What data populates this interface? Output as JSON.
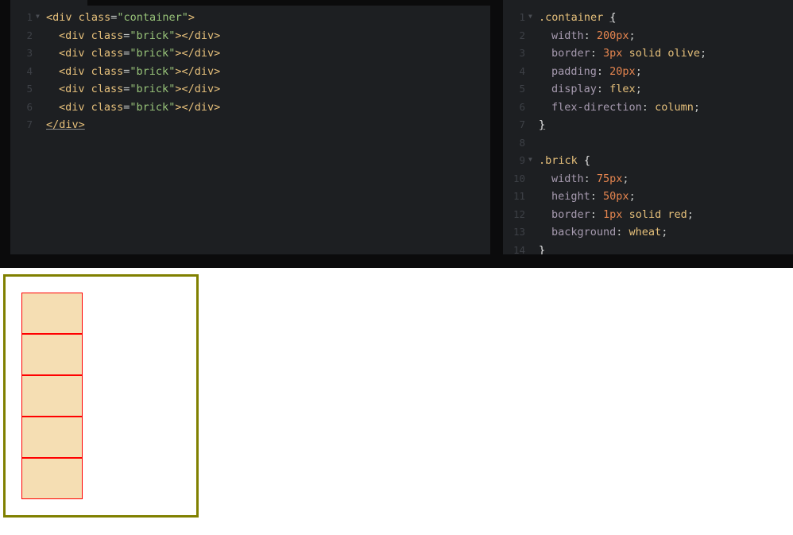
{
  "html_editor": {
    "lines": [
      {
        "n": "1",
        "fold": true,
        "indent": 0,
        "parts": [
          [
            "tag",
            "<div "
          ],
          [
            "attr",
            "class"
          ],
          [
            "punc",
            "="
          ],
          [
            "val",
            "\"container\""
          ],
          [
            "tag",
            ">"
          ]
        ]
      },
      {
        "n": "2",
        "fold": false,
        "indent": 1,
        "parts": [
          [
            "tag",
            "<div "
          ],
          [
            "attr",
            "class"
          ],
          [
            "punc",
            "="
          ],
          [
            "val",
            "\"brick\""
          ],
          [
            "tag",
            "></div>"
          ]
        ]
      },
      {
        "n": "3",
        "fold": false,
        "indent": 1,
        "parts": [
          [
            "tag",
            "<div "
          ],
          [
            "attr",
            "class"
          ],
          [
            "punc",
            "="
          ],
          [
            "val",
            "\"brick\""
          ],
          [
            "tag",
            "></div>"
          ]
        ]
      },
      {
        "n": "4",
        "fold": false,
        "indent": 1,
        "parts": [
          [
            "tag",
            "<div "
          ],
          [
            "attr",
            "class"
          ],
          [
            "punc",
            "="
          ],
          [
            "val",
            "\"brick\""
          ],
          [
            "tag",
            "></div>"
          ]
        ]
      },
      {
        "n": "5",
        "fold": false,
        "indent": 1,
        "parts": [
          [
            "tag",
            "<div "
          ],
          [
            "attr",
            "class"
          ],
          [
            "punc",
            "="
          ],
          [
            "val",
            "\"brick\""
          ],
          [
            "tag",
            "></div>"
          ]
        ]
      },
      {
        "n": "6",
        "fold": false,
        "indent": 1,
        "parts": [
          [
            "tag",
            "<div "
          ],
          [
            "attr",
            "class"
          ],
          [
            "punc",
            "="
          ],
          [
            "val",
            "\"brick\""
          ],
          [
            "tag",
            "></div>"
          ]
        ]
      },
      {
        "n": "7",
        "fold": false,
        "indent": 0,
        "parts": [
          [
            "tag_under",
            "</div>"
          ]
        ]
      }
    ]
  },
  "css_editor": {
    "lines": [
      {
        "n": "1",
        "fold": true,
        "indent": 0,
        "parts": [
          [
            "sel",
            ".container "
          ],
          [
            "brace_under",
            "{"
          ]
        ]
      },
      {
        "n": "2",
        "fold": false,
        "indent": 1,
        "parts": [
          [
            "prop",
            "width"
          ],
          [
            "punc",
            ": "
          ],
          [
            "num",
            "200px"
          ],
          [
            "punc",
            ";"
          ]
        ]
      },
      {
        "n": "3",
        "fold": false,
        "indent": 1,
        "parts": [
          [
            "prop",
            "border"
          ],
          [
            "punc",
            ": "
          ],
          [
            "num",
            "3px"
          ],
          [
            "kw",
            " solid olive"
          ],
          [
            "punc",
            ";"
          ]
        ]
      },
      {
        "n": "4",
        "fold": false,
        "indent": 1,
        "parts": [
          [
            "prop",
            "padding"
          ],
          [
            "punc",
            ": "
          ],
          [
            "num",
            "20px"
          ],
          [
            "punc",
            ";"
          ]
        ]
      },
      {
        "n": "5",
        "fold": false,
        "indent": 1,
        "parts": [
          [
            "prop",
            "display"
          ],
          [
            "punc",
            ": "
          ],
          [
            "kw",
            "flex"
          ],
          [
            "punc",
            ";"
          ]
        ]
      },
      {
        "n": "6",
        "fold": false,
        "indent": 1,
        "parts": [
          [
            "prop",
            "flex-direction"
          ],
          [
            "punc",
            ": "
          ],
          [
            "kw",
            "column"
          ],
          [
            "punc",
            ";"
          ]
        ]
      },
      {
        "n": "7",
        "fold": false,
        "indent": 0,
        "parts": [
          [
            "brace_under",
            "}"
          ]
        ]
      },
      {
        "n": "8",
        "fold": false,
        "indent": 0,
        "parts": []
      },
      {
        "n": "9",
        "fold": true,
        "indent": 0,
        "parts": [
          [
            "sel",
            ".brick "
          ],
          [
            "brace",
            "{"
          ]
        ]
      },
      {
        "n": "10",
        "fold": false,
        "indent": 1,
        "parts": [
          [
            "prop",
            "width"
          ],
          [
            "punc",
            ": "
          ],
          [
            "num",
            "75px"
          ],
          [
            "punc",
            ";"
          ]
        ]
      },
      {
        "n": "11",
        "fold": false,
        "indent": 1,
        "parts": [
          [
            "prop",
            "height"
          ],
          [
            "punc",
            ": "
          ],
          [
            "num",
            "50px"
          ],
          [
            "punc",
            ";"
          ]
        ]
      },
      {
        "n": "12",
        "fold": false,
        "indent": 1,
        "parts": [
          [
            "prop",
            "border"
          ],
          [
            "punc",
            ": "
          ],
          [
            "num",
            "1px"
          ],
          [
            "kw",
            " solid red"
          ],
          [
            "punc",
            ";"
          ]
        ]
      },
      {
        "n": "13",
        "fold": false,
        "indent": 1,
        "parts": [
          [
            "prop",
            "background"
          ],
          [
            "punc",
            ": "
          ],
          [
            "kw",
            "wheat"
          ],
          [
            "punc",
            ";"
          ]
        ]
      },
      {
        "n": "14",
        "fold": false,
        "indent": 0,
        "parts": [
          [
            "brace",
            "}"
          ]
        ]
      }
    ]
  },
  "preview": {
    "brick_count": 5,
    "container_border_color": "#808000",
    "brick_border_color": "#ff0000",
    "brick_background": "#f5deb3"
  },
  "colors": {
    "editor_bg": "#1d1f22",
    "gutter_text": "#3d4046",
    "tag": "#e6c07b",
    "string": "#98c379",
    "number": "#e5854f",
    "property": "#a79bb0"
  }
}
